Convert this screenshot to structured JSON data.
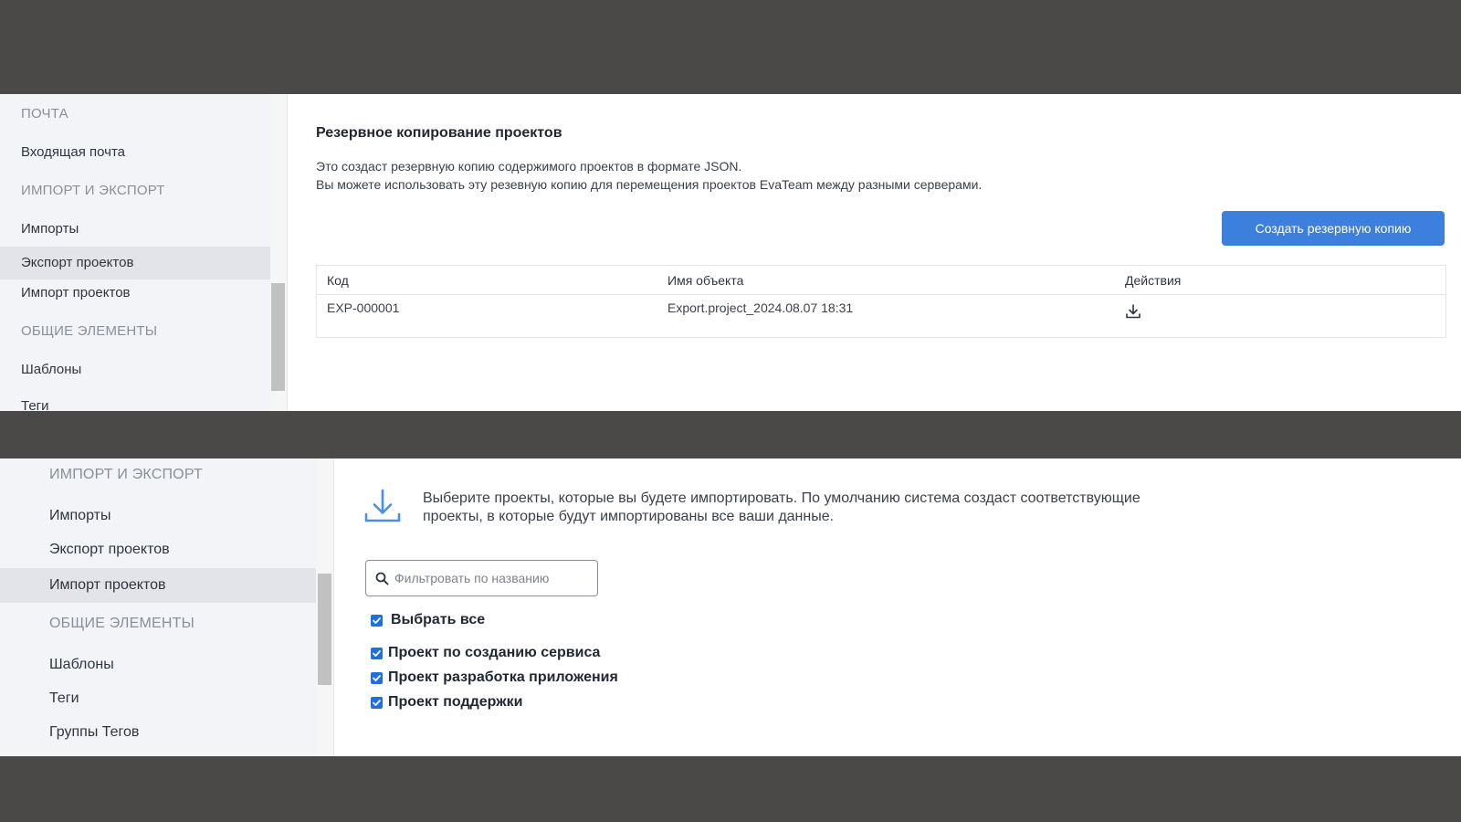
{
  "top": {
    "sidebar": {
      "sections": [
        {
          "label": "ПОЧТА"
        },
        {
          "label": "ИМПОРТ И ЭКСПОРТ"
        },
        {
          "label": "ОБЩИЕ ЭЛЕМЕНТЫ"
        }
      ],
      "items": [
        {
          "label": "Входящая почта"
        },
        {
          "label": "Импорты"
        },
        {
          "label": "Экспорт проектов",
          "active": true
        },
        {
          "label": "Импорт проектов"
        },
        {
          "label": "Шаблоны"
        },
        {
          "label": "Теги"
        }
      ]
    },
    "main": {
      "title": "Резервное копирование проектов",
      "desc_line1": "Это создаст резервную копию содержимого проектов в формате JSON.",
      "desc_line2": "Вы можете использовать эту резевную копию для перемещения проектов EvaTeam между разными серверами.",
      "create_backup_label": "Создать резервную копию",
      "table": {
        "headers": [
          "Код",
          "Имя объекта",
          "Действия"
        ],
        "rows": [
          {
            "code": "EXP-000001",
            "name": "Export.project_2024.08.07 18:31",
            "action_icon": "download-icon"
          }
        ]
      }
    }
  },
  "bottom": {
    "sidebar": {
      "sections": [
        {
          "label": "ИМПОРТ И ЭКСПОРТ"
        },
        {
          "label": "ОБЩИЕ ЭЛЕМЕНТЫ"
        }
      ],
      "items": [
        {
          "label": "Импорты"
        },
        {
          "label": "Экспорт проектов"
        },
        {
          "label": "Импорт проектов",
          "active": true
        },
        {
          "label": "Шаблоны"
        },
        {
          "label": "Теги"
        },
        {
          "label": "Группы Тегов"
        }
      ]
    },
    "main": {
      "info_icon": "download-icon",
      "info_line1": "Выберите проекты, которые вы будете импортировать. По умолчанию система создаст соответствующие",
      "info_line2": "проекты, в которые будут импортированы все ваши данные.",
      "filter_placeholder": "Фильтровать по названию",
      "select_all_label": "Выбрать все",
      "projects": [
        {
          "label": "Проект по созданию сервиса",
          "checked": true
        },
        {
          "label": "Проект разработка приложения",
          "checked": true
        },
        {
          "label": "Проект поддержки",
          "checked": true
        }
      ]
    }
  },
  "colors": {
    "accent": "#3d7fdc",
    "checkbox": "#1f6fe0",
    "backdrop": "#4a4948"
  }
}
